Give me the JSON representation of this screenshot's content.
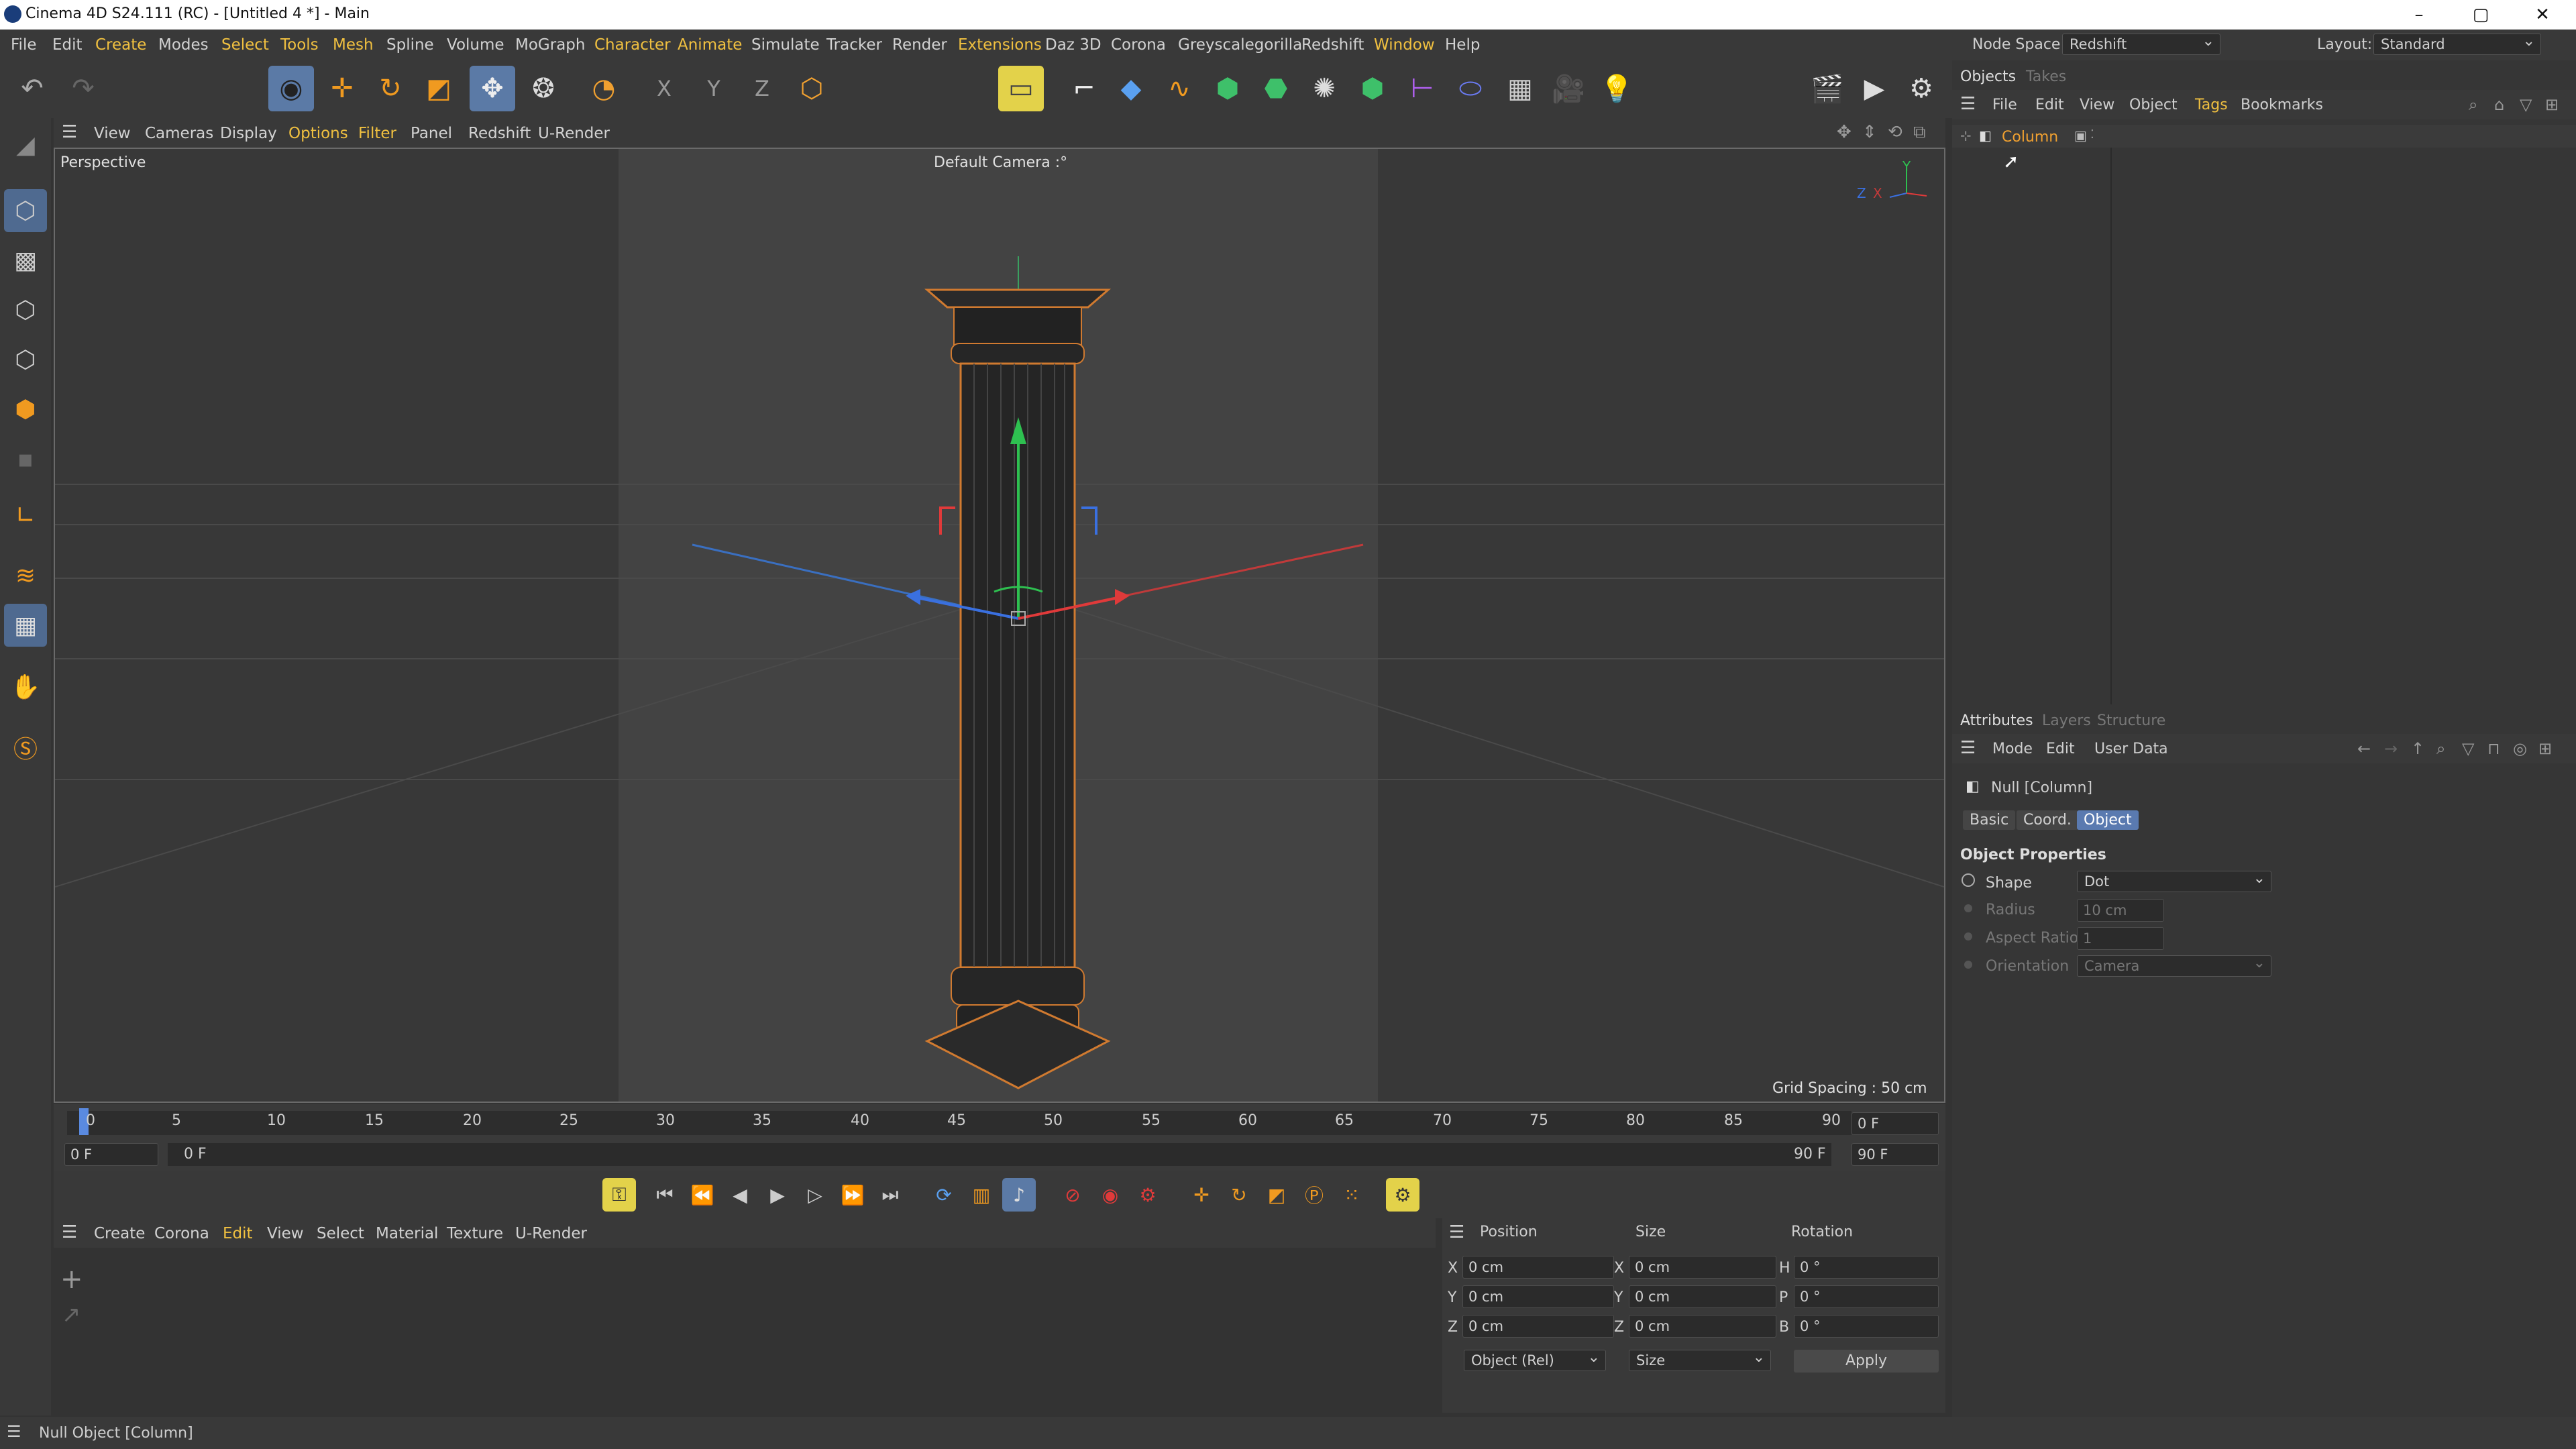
{
  "window": {
    "title": "Cinema 4D S24.111 (RC) - [Untitled 4 *] - Main",
    "minimize": "–",
    "maximize": "▢",
    "close": "✕"
  },
  "menubar": {
    "items": [
      "File",
      "Edit",
      "Create",
      "Modes",
      "Select",
      "Tools",
      "Mesh",
      "Spline",
      "Volume",
      "MoGraph",
      "Character",
      "Animate",
      "Simulate",
      "Tracker",
      "Render",
      "Extensions",
      "Daz 3D",
      "Corona",
      "Greyscalegorilla",
      "Redshift",
      "Window",
      "Help"
    ]
  },
  "nodespace": {
    "label": "Node Space:",
    "value": "Redshift"
  },
  "layout": {
    "label": "Layout:",
    "value": "Standard"
  },
  "viewport": {
    "menu": [
      "View",
      "Cameras",
      "Display",
      "Options",
      "Filter",
      "Panel",
      "Redshift",
      "U-Render"
    ],
    "name": "Perspective",
    "camera": "Default Camera :°",
    "grid": "Grid Spacing : 50 cm",
    "axis": {
      "x": "X",
      "y": "Y",
      "z": "Z"
    }
  },
  "timeline": {
    "ticks": [
      "0",
      "5",
      "10",
      "15",
      "20",
      "25",
      "30",
      "35",
      "40",
      "45",
      "50",
      "55",
      "60",
      "65",
      "70",
      "75",
      "80",
      "85",
      "90"
    ],
    "current_field": "0 F",
    "start_field": "0 F",
    "start_label": "0 F",
    "end_label": "90 F",
    "end_field": "90 F",
    "right_field": "0 F"
  },
  "materials": {
    "menu": [
      "Create",
      "Corona",
      "Edit",
      "View",
      "Select",
      "Material",
      "Texture",
      "U-Render"
    ]
  },
  "coords": {
    "headers": [
      "Position",
      "Size",
      "Rotation"
    ],
    "rows": [
      {
        "axis": "X",
        "pos": "0 cm",
        "size_axis": "X",
        "size": "0 cm",
        "rot_axis": "H",
        "rot": "0 °"
      },
      {
        "axis": "Y",
        "pos": "0 cm",
        "size_axis": "Y",
        "size": "0 cm",
        "rot_axis": "P",
        "rot": "0 °"
      },
      {
        "axis": "Z",
        "pos": "0 cm",
        "size_axis": "Z",
        "size": "0 cm",
        "rot_axis": "B",
        "rot": "0 °"
      }
    ],
    "mode": "Object (Rel)",
    "sizemode": "Size",
    "apply": "Apply"
  },
  "objects": {
    "tabs": [
      "Objects",
      "Takes"
    ],
    "menu": [
      "File",
      "Edit",
      "View",
      "Object",
      "Tags",
      "Bookmarks"
    ],
    "item": "Column"
  },
  "attributes": {
    "tabs": [
      "Attributes",
      "Layers",
      "Structure"
    ],
    "menu": [
      "Mode",
      "Edit",
      "User Data"
    ],
    "object": "Null [Column]",
    "subtabs": [
      "Basic",
      "Coord.",
      "Object"
    ],
    "section": "Object Properties",
    "props": [
      {
        "label": "Shape",
        "value": "Dot"
      },
      {
        "label": "Radius",
        "value": "10 cm"
      },
      {
        "label": "Aspect Ratio",
        "value": "1"
      },
      {
        "label": "Orientation",
        "value": "Camera"
      }
    ]
  },
  "status": {
    "text": "Null Object [Column]"
  }
}
